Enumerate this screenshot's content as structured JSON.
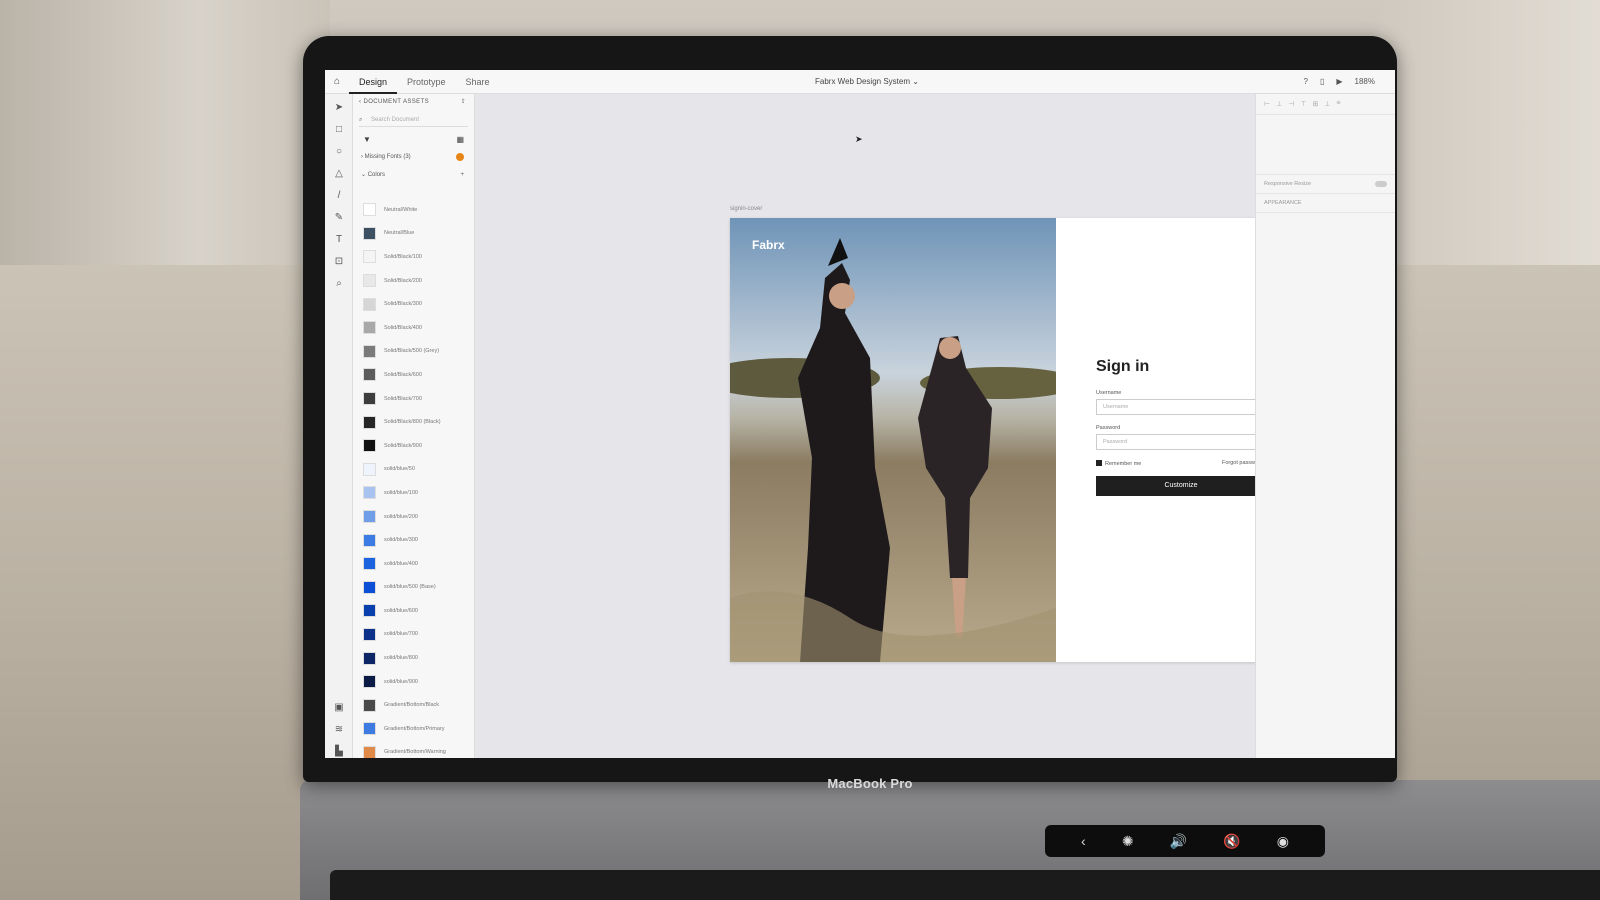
{
  "topbar": {
    "tabs": [
      {
        "label": "Design"
      },
      {
        "label": "Prototype"
      },
      {
        "label": "Share"
      }
    ],
    "doc_title": "Fabrx Web Design System ⌄",
    "zoom": "188%"
  },
  "assets": {
    "header": "‹ DOCUMENT ASSETS",
    "search_placeholder": "Search Document",
    "missing_fonts": "Missing Fonts (3)",
    "colors_label": "Colors",
    "swatches": [
      {
        "name": "Neutral/White",
        "color": "#ffffff"
      },
      {
        "name": "Neutral/Blue",
        "color": "#3c4f63"
      },
      {
        "name": "Solid/Black/100",
        "color": "#f4f4f4"
      },
      {
        "name": "Solid/Black/200",
        "color": "#e8e8e8"
      },
      {
        "name": "Solid/Black/300",
        "color": "#d6d6d6"
      },
      {
        "name": "Solid/Black/400",
        "color": "#a8a8a8"
      },
      {
        "name": "Solid/Black/500 (Grey)",
        "color": "#7a7a7a"
      },
      {
        "name": "Solid/Black/600",
        "color": "#5c5c5c"
      },
      {
        "name": "Solid/Black/700",
        "color": "#3d3d3d"
      },
      {
        "name": "Solid/Black/800 (Black)",
        "color": "#262626"
      },
      {
        "name": "Solid/Black/900",
        "color": "#111111"
      },
      {
        "name": "solid/blue/50",
        "color": "#eef3fc"
      },
      {
        "name": "solid/blue/100",
        "color": "#a9c3f0"
      },
      {
        "name": "solid/blue/200",
        "color": "#6f9de8"
      },
      {
        "name": "solid/blue/300",
        "color": "#3b7be3"
      },
      {
        "name": "solid/blue/400",
        "color": "#1c63e0"
      },
      {
        "name": "solid/blue/500 (Base)",
        "color": "#0a4fd6"
      },
      {
        "name": "solid/blue/600",
        "color": "#0a3fae"
      },
      {
        "name": "solid/blue/700",
        "color": "#0b318a"
      },
      {
        "name": "solid/blue/800",
        "color": "#0d2668"
      },
      {
        "name": "solid/blue/900",
        "color": "#0b1b45"
      },
      {
        "name": "Gradient/Bottom/Black",
        "color": "#4a4a4a"
      },
      {
        "name": "Gradient/Bottom/Primary",
        "color": "#3d7be0"
      },
      {
        "name": "Gradient/Bottom/Warning",
        "color": "#e08a4a"
      }
    ]
  },
  "canvas": {
    "artboard_label": "signin-cover",
    "brand": "Fabrx",
    "signin": {
      "title": "Sign in",
      "username_label": "Username",
      "username_placeholder": "Username",
      "password_label": "Password",
      "password_placeholder": "Password",
      "remember": "Remember me",
      "forgot": "Forgot password?",
      "button": "Customize"
    }
  },
  "props": {
    "responsive_resize": "Responsive Resize",
    "appearance": "APPEARANCE"
  },
  "laptop": {
    "brand": "MacBook Pro"
  }
}
